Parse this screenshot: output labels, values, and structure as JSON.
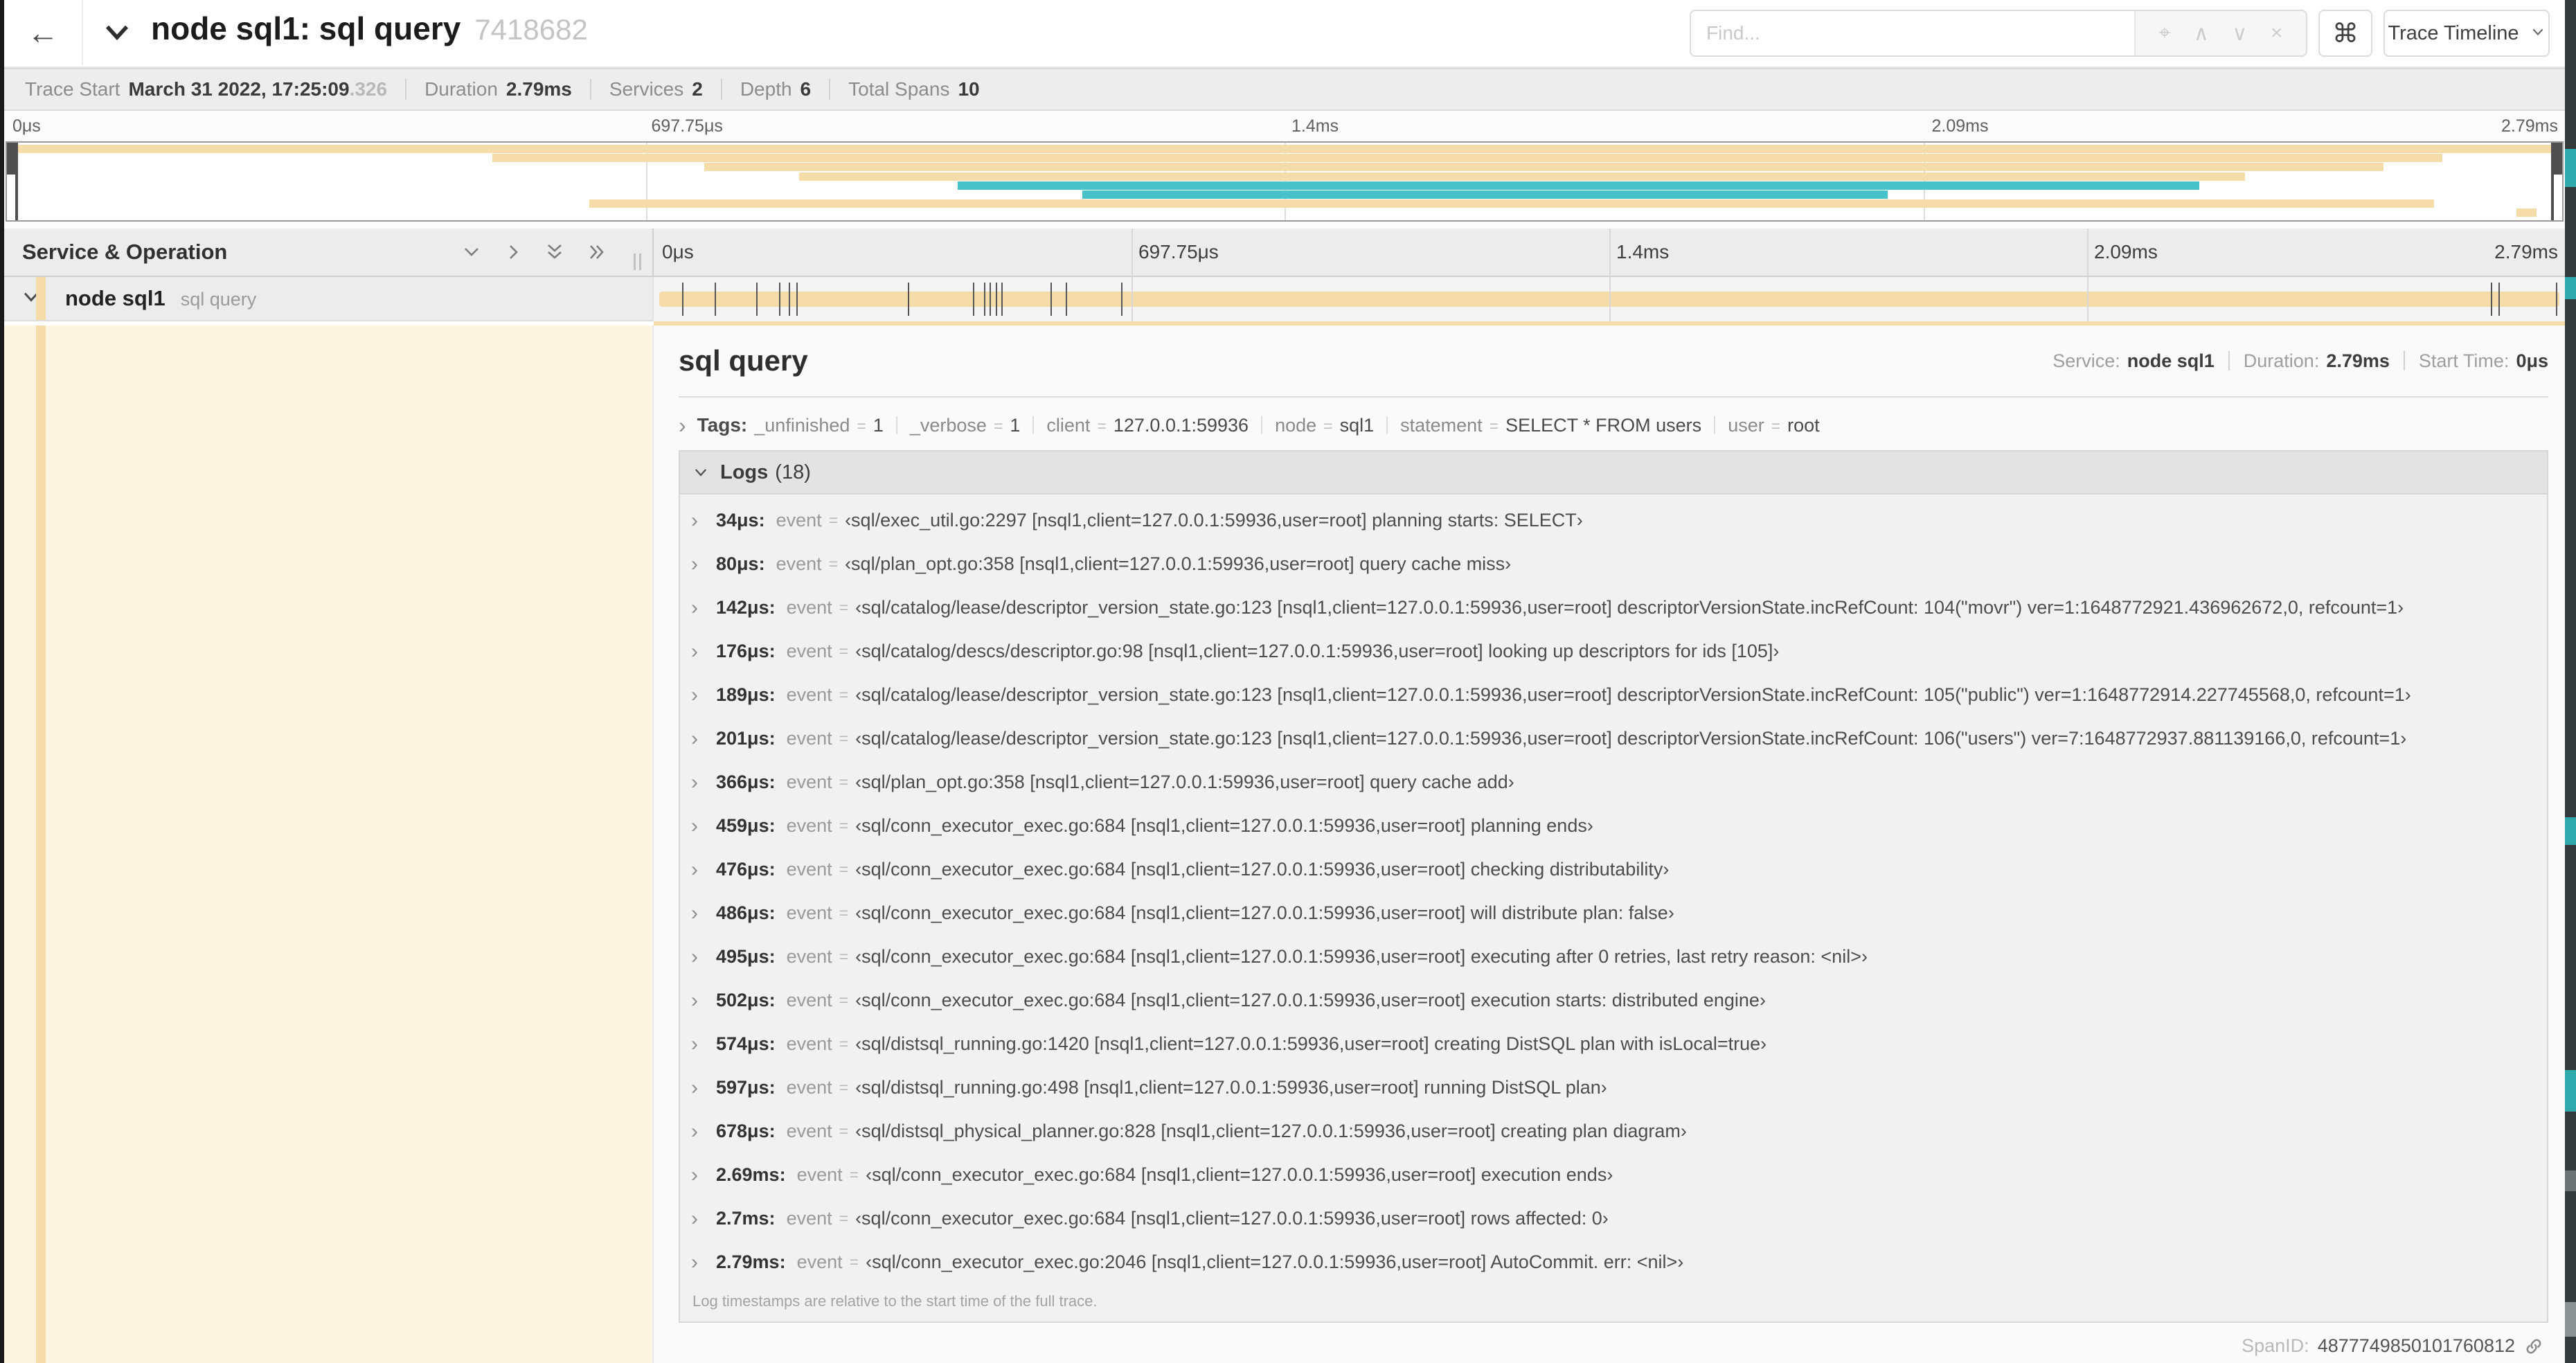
{
  "colors": {
    "tan": "#f5dca8",
    "teal": "#46c2c8",
    "selected_row_bg": "#ececec",
    "detail_left_bg": "#fcf5e2"
  },
  "header": {
    "back_glyph": "←",
    "title": "node sql1: sql query",
    "trace_id_short": "7418682",
    "find_placeholder": "Find...",
    "find_controls": [
      {
        "name": "target-icon",
        "glyph": "⌖"
      },
      {
        "name": "chevron-up-icon",
        "glyph": "∧"
      },
      {
        "name": "chevron-down-icon",
        "glyph": "∨"
      },
      {
        "name": "clear-icon",
        "glyph": "×"
      }
    ],
    "shortcuts_glyph": "⌘",
    "view_selector_label": "Trace Timeline"
  },
  "summary": {
    "items": [
      {
        "label": "Trace Start",
        "value": "March 31 2022, 17:25:09",
        "suffix": ".326"
      },
      {
        "label": "Duration",
        "value": "2.79ms"
      },
      {
        "label": "Services",
        "value": "2"
      },
      {
        "label": "Depth",
        "value": "6"
      },
      {
        "label": "Total Spans",
        "value": "10"
      }
    ]
  },
  "minimap": {
    "rows": [
      {
        "start": 0,
        "end": 100,
        "color": "tan"
      },
      {
        "start": 19,
        "end": 95.3,
        "color": "tan"
      },
      {
        "start": 27.3,
        "end": 93,
        "color": "tan"
      },
      {
        "start": 31,
        "end": 87.6,
        "color": "tan"
      },
      {
        "start": 37.2,
        "end": 85.8,
        "color": "teal"
      },
      {
        "start": 42.1,
        "end": 73.6,
        "color": "teal"
      },
      {
        "start": 22.8,
        "end": 95,
        "color": "tan"
      },
      {
        "start": 98.2,
        "end": 99,
        "color": "tan"
      }
    ]
  },
  "timeline": {
    "left_header": "Service & Operation",
    "collapse_controls": [
      {
        "name": "collapse-one-icon",
        "icon": "chevron-down"
      },
      {
        "name": "expand-one-icon",
        "icon": "chevron-right"
      },
      {
        "name": "collapse-all-icon",
        "icon": "double-chevron-down"
      },
      {
        "name": "expand-all-icon",
        "icon": "double-chevron-right"
      }
    ],
    "ruler_ticks": [
      "0μs",
      "697.75μs",
      "1.4ms",
      "2.09ms",
      "2.79ms"
    ],
    "span_row": {
      "service": "node sql1",
      "operation": "sql query",
      "log_marker_positions": [
        1.2,
        2.9,
        5.1,
        6.3,
        6.8,
        7.2,
        13.1,
        16.5,
        17.1,
        17.4,
        17.7,
        18,
        20.6,
        21.4,
        24.3,
        96.4,
        96.8,
        99.8
      ]
    }
  },
  "detail": {
    "operation": "sql query",
    "meta": [
      {
        "label": "Service:",
        "value": "node sql1"
      },
      {
        "label": "Duration:",
        "value": "2.79ms"
      },
      {
        "label": "Start Time:",
        "value": "0μs"
      }
    ],
    "tags_label": "Tags:",
    "tags": [
      {
        "key": "_unfinished",
        "value": "1"
      },
      {
        "key": "_verbose",
        "value": "1"
      },
      {
        "key": "client",
        "value": "127.0.0.1:59936"
      },
      {
        "key": "node",
        "value": "sql1"
      },
      {
        "key": "statement",
        "value": "SELECT * FROM users"
      },
      {
        "key": "user",
        "value": "root"
      }
    ],
    "logs_label": "Logs",
    "logs_count": "(18)",
    "log_field_name": "event",
    "logs": [
      {
        "time": "34μs",
        "value": "‹sql/exec_util.go:2297 [nsql1,client=127.0.0.1:59936,user=root] planning starts: SELECT›"
      },
      {
        "time": "80μs",
        "value": "‹sql/plan_opt.go:358 [nsql1,client=127.0.0.1:59936,user=root] query cache miss›"
      },
      {
        "time": "142μs",
        "value": "‹sql/catalog/lease/descriptor_version_state.go:123 [nsql1,client=127.0.0.1:59936,user=root] descriptorVersionState.incRefCount: 104(\"movr\") ver=1:1648772921.436962672,0, refcount=1›"
      },
      {
        "time": "176μs",
        "value": "‹sql/catalog/descs/descriptor.go:98 [nsql1,client=127.0.0.1:59936,user=root] looking up descriptors for ids [105]›"
      },
      {
        "time": "189μs",
        "value": "‹sql/catalog/lease/descriptor_version_state.go:123 [nsql1,client=127.0.0.1:59936,user=root] descriptorVersionState.incRefCount: 105(\"public\") ver=1:1648772914.227745568,0, refcount=1›"
      },
      {
        "time": "201μs",
        "value": "‹sql/catalog/lease/descriptor_version_state.go:123 [nsql1,client=127.0.0.1:59936,user=root] descriptorVersionState.incRefCount: 106(\"users\") ver=7:1648772937.881139166,0, refcount=1›"
      },
      {
        "time": "366μs",
        "value": "‹sql/plan_opt.go:358 [nsql1,client=127.0.0.1:59936,user=root] query cache add›"
      },
      {
        "time": "459μs",
        "value": "‹sql/conn_executor_exec.go:684 [nsql1,client=127.0.0.1:59936,user=root] planning ends›"
      },
      {
        "time": "476μs",
        "value": "‹sql/conn_executor_exec.go:684 [nsql1,client=127.0.0.1:59936,user=root] checking distributability›"
      },
      {
        "time": "486μs",
        "value": "‹sql/conn_executor_exec.go:684 [nsql1,client=127.0.0.1:59936,user=root] will distribute plan: false›"
      },
      {
        "time": "495μs",
        "value": "‹sql/conn_executor_exec.go:684 [nsql1,client=127.0.0.1:59936,user=root] executing after 0 retries, last retry reason: <nil>›"
      },
      {
        "time": "502μs",
        "value": "‹sql/conn_executor_exec.go:684 [nsql1,client=127.0.0.1:59936,user=root] execution starts: distributed engine›"
      },
      {
        "time": "574μs",
        "value": "‹sql/distsql_running.go:1420 [nsql1,client=127.0.0.1:59936,user=root] creating DistSQL plan with isLocal=true›"
      },
      {
        "time": "597μs",
        "value": "‹sql/distsql_running.go:498 [nsql1,client=127.0.0.1:59936,user=root] running DistSQL plan›"
      },
      {
        "time": "678μs",
        "value": "‹sql/distsql_physical_planner.go:828 [nsql1,client=127.0.0.1:59936,user=root] creating plan diagram›"
      },
      {
        "time": "2.69ms",
        "value": "‹sql/conn_executor_exec.go:684 [nsql1,client=127.0.0.1:59936,user=root] execution ends›"
      },
      {
        "time": "2.7ms",
        "value": "‹sql/conn_executor_exec.go:684 [nsql1,client=127.0.0.1:59936,user=root] rows affected: 0›"
      },
      {
        "time": "2.79ms",
        "value": "‹sql/conn_executor_exec.go:2046 [nsql1,client=127.0.0.1:59936,user=root] AutoCommit. err: <nil>›"
      }
    ],
    "logs_note": "Log timestamps are relative to the start time of the full trace.",
    "span_id_label": "SpanID:",
    "span_id": "4877749850101760812"
  }
}
